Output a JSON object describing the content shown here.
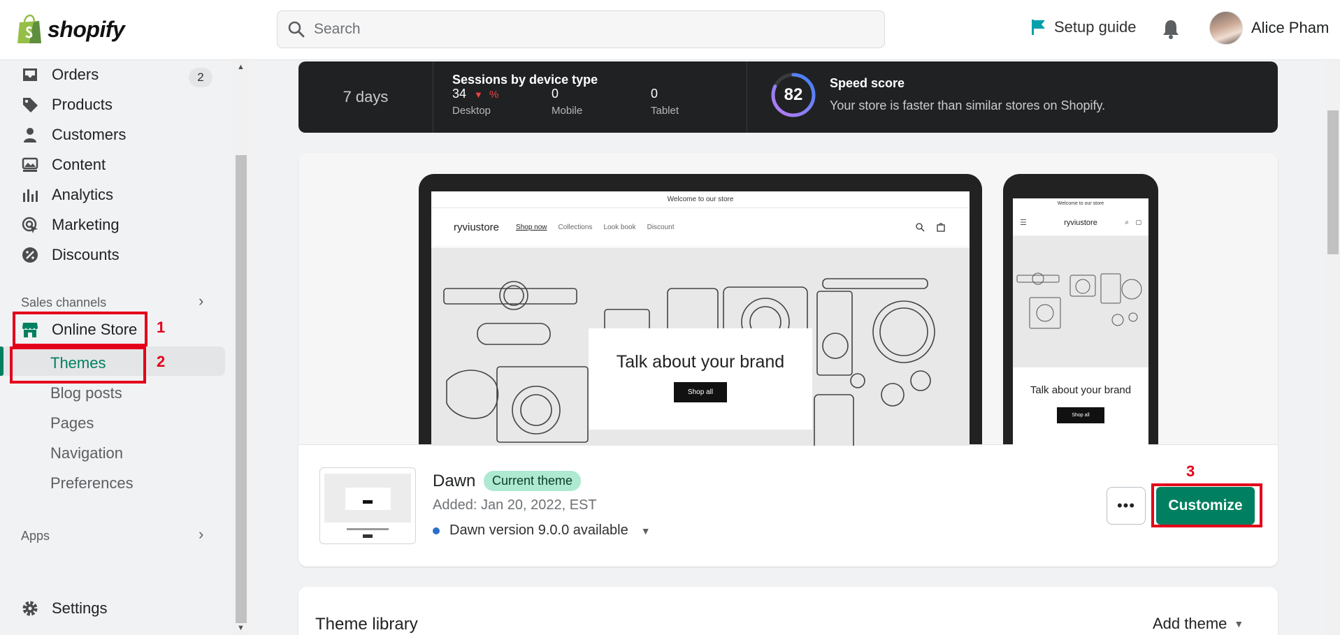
{
  "brand": {
    "name": "shopify"
  },
  "search": {
    "placeholder": "Search"
  },
  "topbar": {
    "setup_guide": "Setup guide",
    "user_name": "Alice Pham"
  },
  "sidebar": {
    "items": [
      {
        "label": "Orders",
        "icon": "orders-icon",
        "count": "2"
      },
      {
        "label": "Products",
        "icon": "tag-icon"
      },
      {
        "label": "Customers",
        "icon": "person-icon"
      },
      {
        "label": "Content",
        "icon": "image-icon"
      },
      {
        "label": "Analytics",
        "icon": "bar-chart-icon"
      },
      {
        "label": "Marketing",
        "icon": "target-icon"
      },
      {
        "label": "Discounts",
        "icon": "discount-icon"
      }
    ],
    "sales_channels_label": "Sales channels",
    "online_store": "Online Store",
    "sub_items": [
      "Themes",
      "Blog posts",
      "Pages",
      "Navigation",
      "Preferences"
    ],
    "apps_label": "Apps",
    "settings": "Settings",
    "annotations": [
      "1",
      "2",
      "3"
    ]
  },
  "speed": {
    "period": "7 days",
    "sessions_title": "Sessions by device type",
    "desktop_value": "34",
    "desktop_change": "%",
    "desktop_label": "Desktop",
    "mobile_value": "0",
    "mobile_label": "Mobile",
    "tablet_value": "0",
    "tablet_label": "Tablet",
    "score": "82",
    "score_fraction": 0.82,
    "score_title": "Speed score",
    "score_subtitle": "Your store is faster than similar stores on Shopify."
  },
  "preview": {
    "announcement": "Welcome to our store",
    "store_name": "ryviustore",
    "nav": [
      "Shop now",
      "Collections",
      "Look book",
      "Discount"
    ],
    "hero_title": "Talk about your brand",
    "hero_button": "Shop all"
  },
  "theme": {
    "name": "Dawn",
    "badge": "Current theme",
    "added": "Added: Jan 20, 2022, EST",
    "version": "Dawn version 9.0.0 available",
    "more": "•••",
    "customize": "Customize"
  },
  "library": {
    "title": "Theme library",
    "add_theme": "Add theme"
  },
  "colors": {
    "accent": "#008060",
    "annotation": "#e3001b",
    "banner": "#202123",
    "badge": "#aee9d1"
  }
}
